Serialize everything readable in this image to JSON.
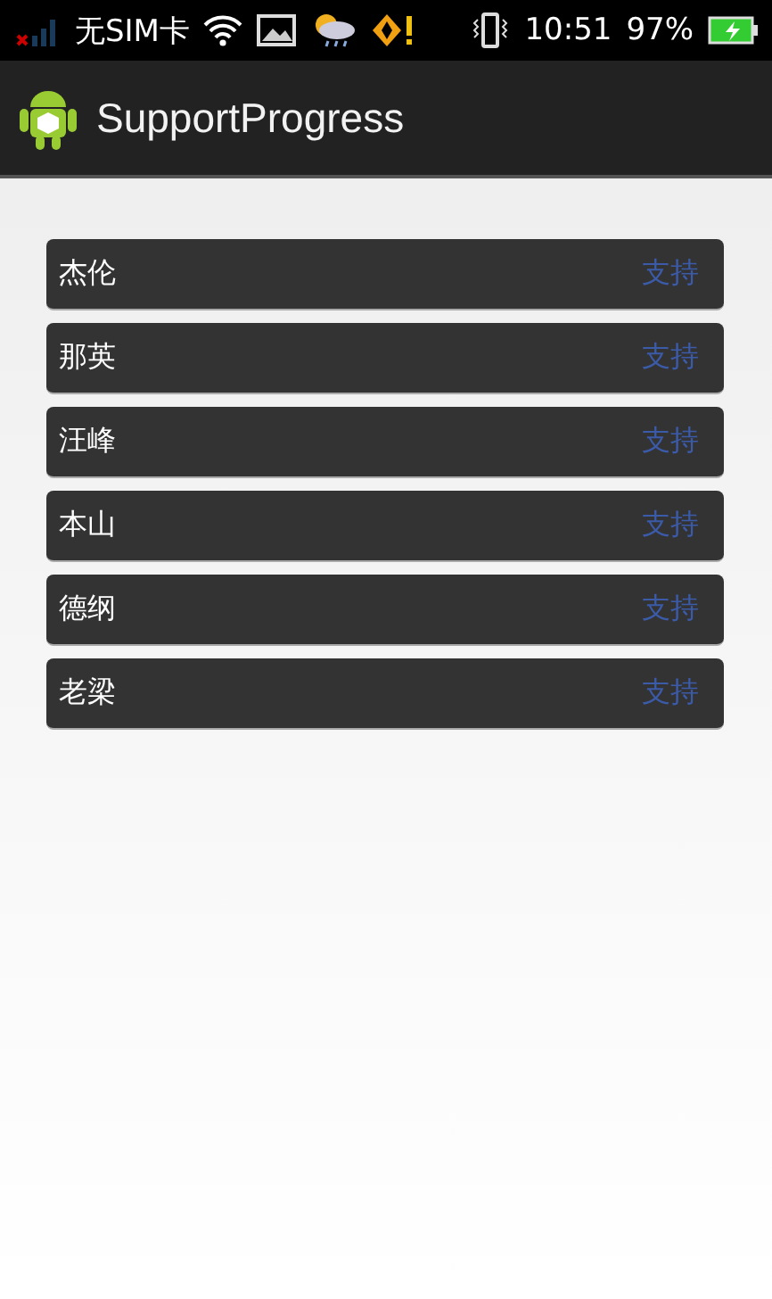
{
  "status_bar": {
    "carrier": "无SIM卡",
    "time": "10:51",
    "battery": "97%"
  },
  "action_bar": {
    "title": "SupportProgress"
  },
  "rows": [
    {
      "name": "杰伦",
      "action": "支持"
    },
    {
      "name": "那英",
      "action": "支持"
    },
    {
      "name": "汪峰",
      "action": "支持"
    },
    {
      "name": "本山",
      "action": "支持"
    },
    {
      "name": "德纲",
      "action": "支持"
    },
    {
      "name": "老梁",
      "action": "支持"
    }
  ]
}
